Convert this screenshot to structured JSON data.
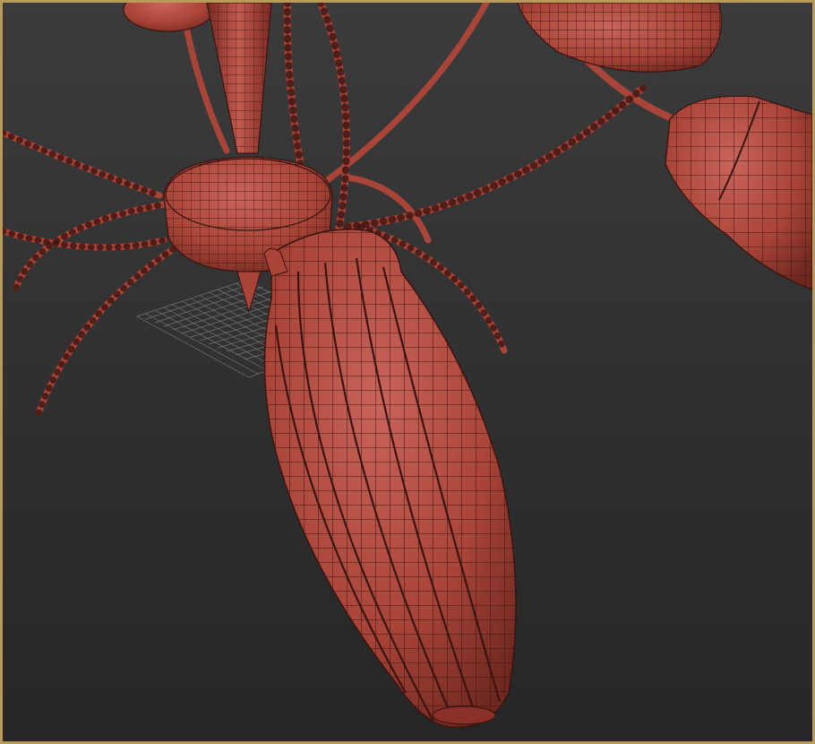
{
  "viewport": {
    "background_top": "#3a3a3a",
    "background_bottom": "#262626",
    "active_border_color": "#b89a5a",
    "render_mode": "edged-faces"
  },
  "scene": {
    "model": "chandelier-arm-lamp",
    "material_color": "#b24a3c",
    "edge_color": "#3a1410",
    "grid_color": "#8a8a8a"
  }
}
